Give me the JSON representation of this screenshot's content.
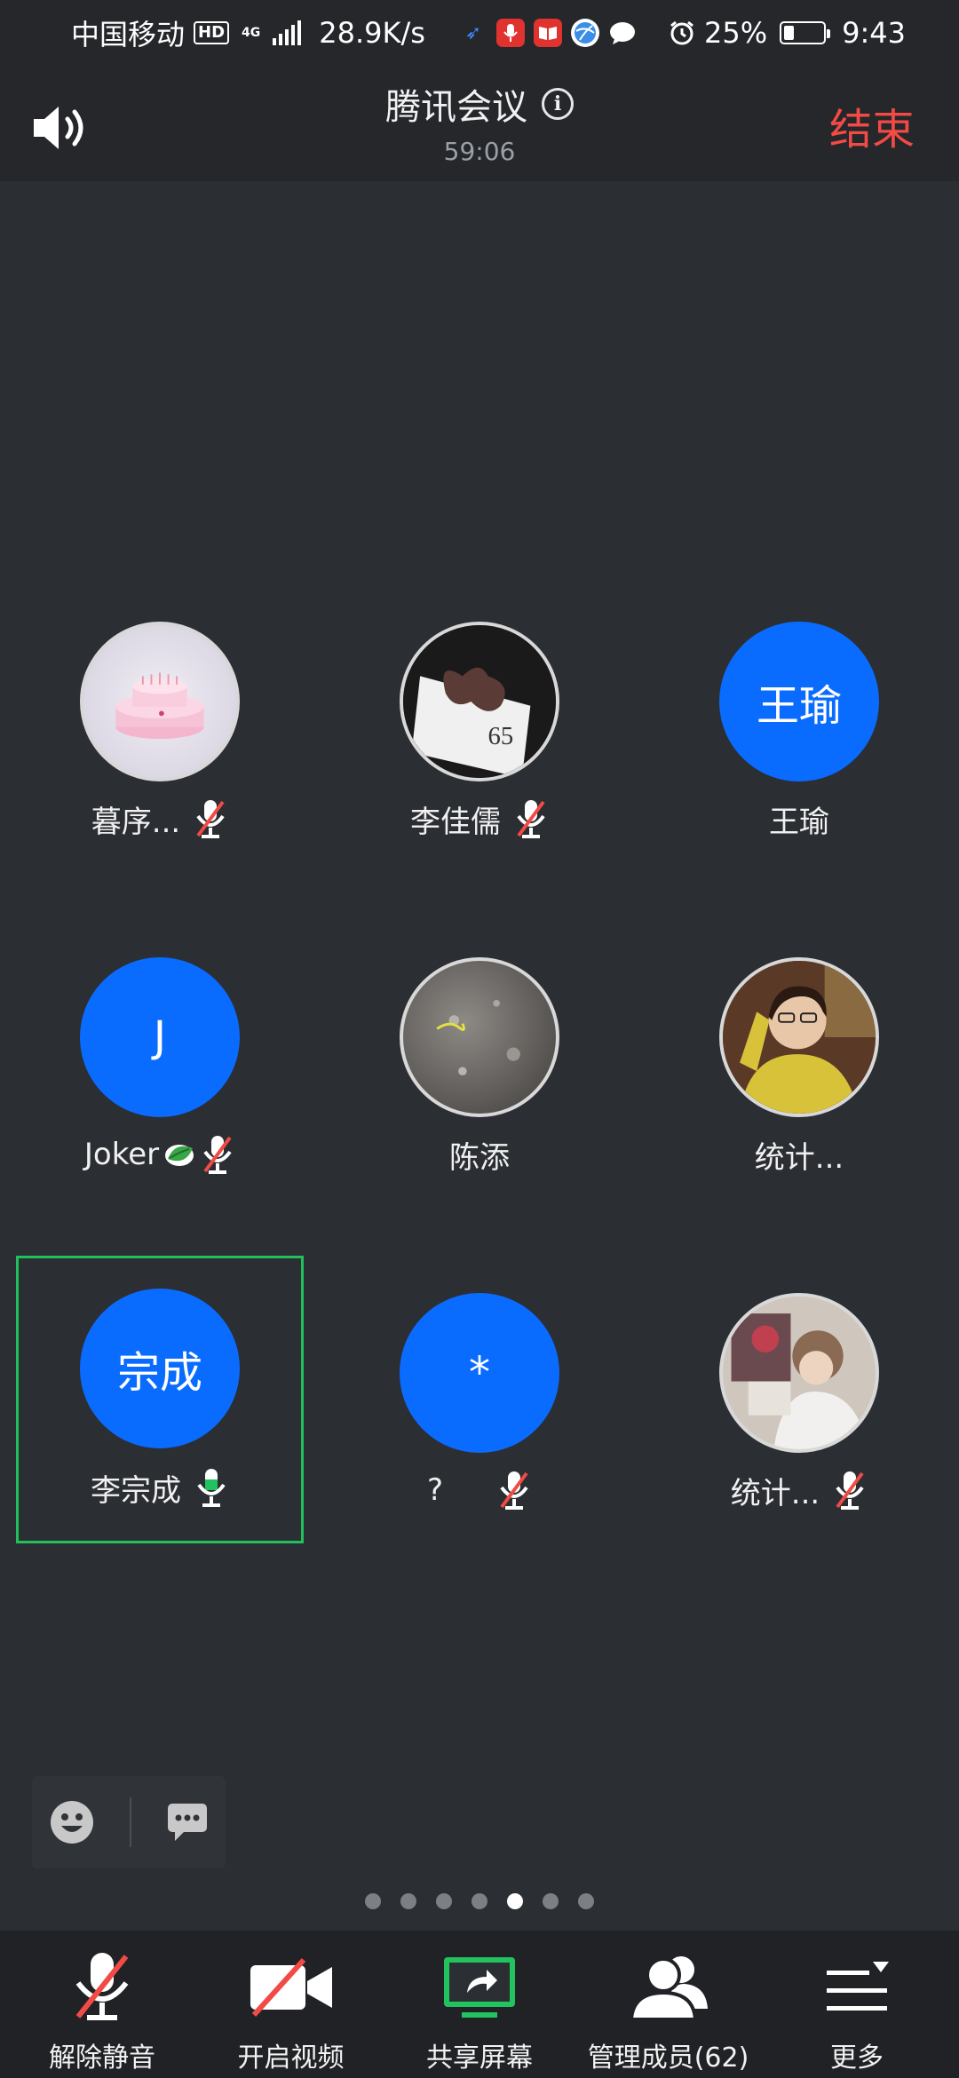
{
  "status_bar": {
    "carrier": "中国移动",
    "hd": "HD",
    "network_gen": "4G",
    "speed": "28.9K/s",
    "battery_percent": "25%",
    "battery_level": 0.25,
    "time": "9:43",
    "app_icons": [
      "arrows-icon",
      "mic-app-icon",
      "book-app-icon",
      "globe-app-icon",
      "chat-bubble-icon"
    ]
  },
  "header": {
    "title": "腾讯会议",
    "timer": "59:06",
    "end_label": "结束"
  },
  "participants": [
    {
      "name": "暮序...",
      "avatar_type": "photo",
      "avatar_text": "",
      "mic": "muted"
    },
    {
      "name": "李佳儒",
      "avatar_type": "photo",
      "avatar_text": "",
      "mic": "muted"
    },
    {
      "name": "王瑜",
      "avatar_type": "text",
      "avatar_text": "王瑜",
      "mic": "none"
    },
    {
      "name": "Joker",
      "avatar_type": "text",
      "avatar_text": "J",
      "mic": "muted",
      "emoji": "leaf"
    },
    {
      "name": "陈添",
      "avatar_type": "photo",
      "avatar_text": "",
      "mic": "none"
    },
    {
      "name": "统计...",
      "avatar_type": "photo",
      "avatar_text": "",
      "mic": "none"
    },
    {
      "name": "李宗成",
      "avatar_type": "text",
      "avatar_text": "宗成",
      "mic": "on",
      "active": true
    },
    {
      "name": "?",
      "avatar_type": "text",
      "avatar_text": "*",
      "mic": "muted"
    },
    {
      "name": "统计...",
      "avatar_type": "photo",
      "avatar_text": "",
      "mic": "muted"
    }
  ],
  "pagination": {
    "total": 7,
    "current": 5
  },
  "toolbar": {
    "unmute_label": "解除静音",
    "video_label": "开启视频",
    "share_label": "共享屏幕",
    "members_label": "管理成员(62)",
    "more_label": "更多"
  },
  "colors": {
    "accent_blue": "#0a6cff",
    "end_red": "#f24a45",
    "active_green": "#20c05c",
    "share_green": "#22c35e"
  }
}
